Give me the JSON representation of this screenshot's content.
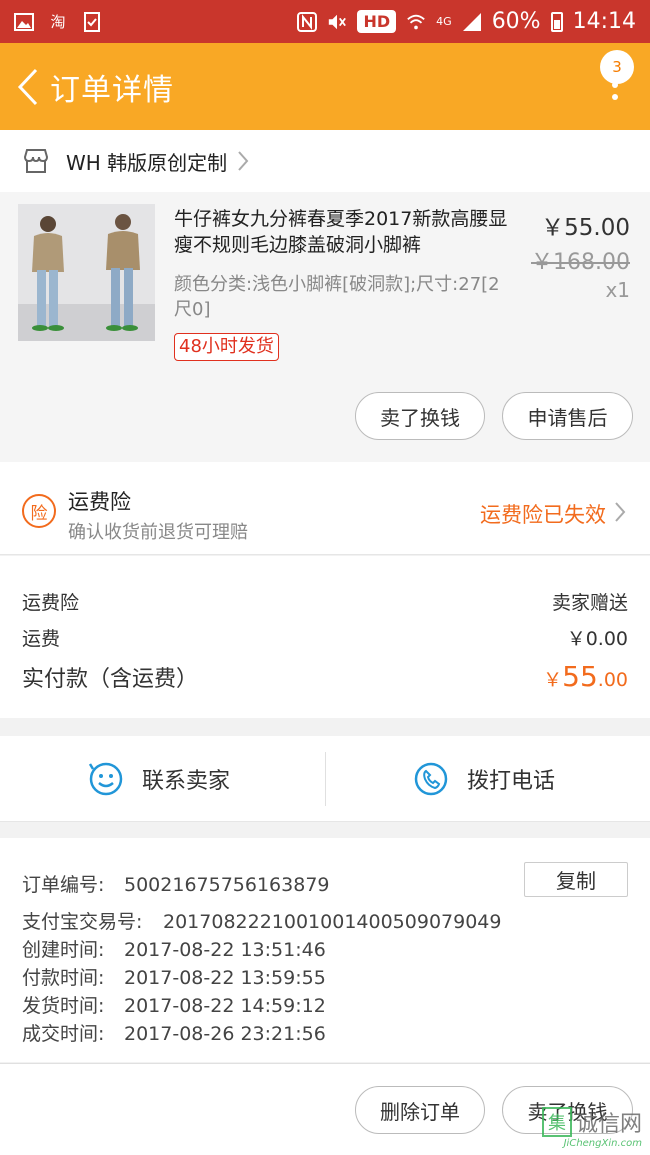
{
  "status_bar": {
    "icons": [
      "gallery-icon",
      "taobao-icon",
      "checklist-icon",
      "nfc-icon",
      "mute-icon",
      "wifi-icon",
      "signal-icon",
      "battery-icon"
    ],
    "left_glyph_2": "淘",
    "hd": "HD",
    "network": "4G",
    "battery": "60%",
    "time": "14:14"
  },
  "header": {
    "title": "订单详情",
    "badge_count": "3",
    "accent": "#f9a825"
  },
  "shop": {
    "name": "WH 韩版原创定制"
  },
  "product": {
    "title": "牛仔裤女九分裤春夏季2017新款高腰显瘦不规则毛边膝盖破洞小脚裤",
    "spec": "颜色分类:浅色小脚裤[破洞款];尺寸:27[2尺0]",
    "tag": "48小时发货",
    "price": "￥55.00",
    "original_price": "￥168.00",
    "qty": "x1",
    "btn_sell": "卖了换钱",
    "btn_aftersale": "申请售后"
  },
  "insurance": {
    "icon_char": "险",
    "title": "运费险",
    "subtitle": "确认收货前退货可理赔",
    "status": "运费险已失效",
    "status_color": "#f26b1d"
  },
  "costs": {
    "row1_label": "运费险",
    "row1_value": "卖家赠送",
    "row2_label": "运费",
    "row2_value": "￥0.00",
    "total_label": "实付款（含运费）",
    "total_symbol": "￥",
    "total_int": "55",
    "total_dec": ".00"
  },
  "contact": {
    "seller": "联系卖家",
    "call": "拨打电话"
  },
  "order_info": {
    "order_no_label": "订单编号:",
    "order_no": "50021675756163879",
    "copy": "复制",
    "alipay_label": "支付宝交易号:",
    "alipay_no": "2017082221001001400509079049",
    "created_label": "创建时间:",
    "created": "2017-08-22 13:51:46",
    "paid_label": "付款时间:",
    "paid": "2017-08-22 13:59:55",
    "shipped_label": "发货时间:",
    "shipped": "2017-08-22 14:59:12",
    "closed_label": "成交时间:",
    "closed": "2017-08-26 23:21:56"
  },
  "bottom": {
    "delete": "删除订单",
    "sell": "卖了换钱"
  },
  "watermark": {
    "box_char": "集",
    "text": "诚信网",
    "url": "JiChengXin.com"
  }
}
